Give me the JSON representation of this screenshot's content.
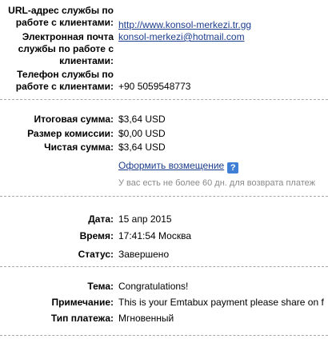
{
  "merchant": {
    "url_label_line1": "URL-адрес службы по",
    "url_label_line2": "работе с клиентами:",
    "url_value": "http://www.konsol-merkezi.tr.gg",
    "email_label_line1": "Электронная почта",
    "email_label_line2": "службы по работе с",
    "email_label_line3": "клиентами:",
    "email_value": "konsol-merkezi@hotmail.com",
    "phone_label_line1": "Телефон службы по",
    "phone_label_line2": "работе с клиентами:",
    "phone_value": "+90 5059548773"
  },
  "amounts": {
    "total_label": "Итоговая сумма:",
    "total_value": "$3,64 USD",
    "fee_label": "Размер комиссии:",
    "fee_value": "$0,00 USD",
    "net_label": "Чистая сумма:",
    "net_value": "$3,64 USD",
    "refund_link": "Оформить возмещение",
    "help_icon_glyph": "?",
    "refund_note": "У вас есть не более 60 дн. для возврата платеж"
  },
  "details": {
    "date_label": "Дата:",
    "date_value": "15 апр 2015",
    "time_label": "Время:",
    "time_value": "17:41:54 Москва",
    "status_label": "Статус:",
    "status_value": "Завершено"
  },
  "message": {
    "subject_label": "Тема:",
    "subject_value": "Congratulations!",
    "note_label": "Примечание:",
    "note_value": "This is your Emtabux payment please share on f",
    "type_label": "Тип платежа:",
    "type_value": "Мгновенный"
  },
  "colors": {
    "link": "#1a3c8c",
    "separator": "#a8a8a8",
    "help_icon": "#3f7fd6",
    "muted_text": "#8a8a8a"
  }
}
